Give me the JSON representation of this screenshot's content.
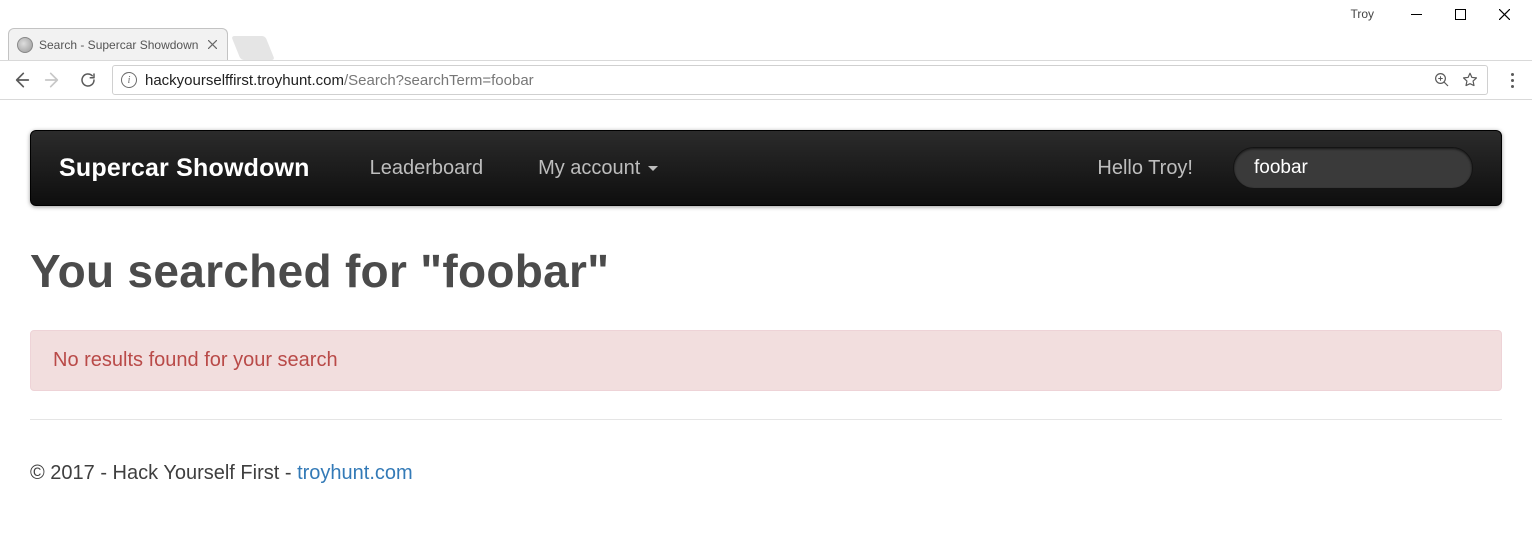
{
  "browser": {
    "user_label": "Troy",
    "tab_title": "Search - Supercar Showdown",
    "url_host": "hackyourselffirst.troyhunt.com",
    "url_path": "/Search?searchTerm=foobar"
  },
  "navbar": {
    "brand": "Supercar Showdown",
    "links": {
      "leaderboard": "Leaderboard",
      "account": "My account"
    },
    "greeting": "Hello Troy!",
    "search_value": "foobar"
  },
  "content": {
    "heading": "You searched for \"foobar\"",
    "no_results": "No results found for your search"
  },
  "footer": {
    "prefix": "© 2017 - Hack Yourself First - ",
    "link_text": "troyhunt.com"
  }
}
